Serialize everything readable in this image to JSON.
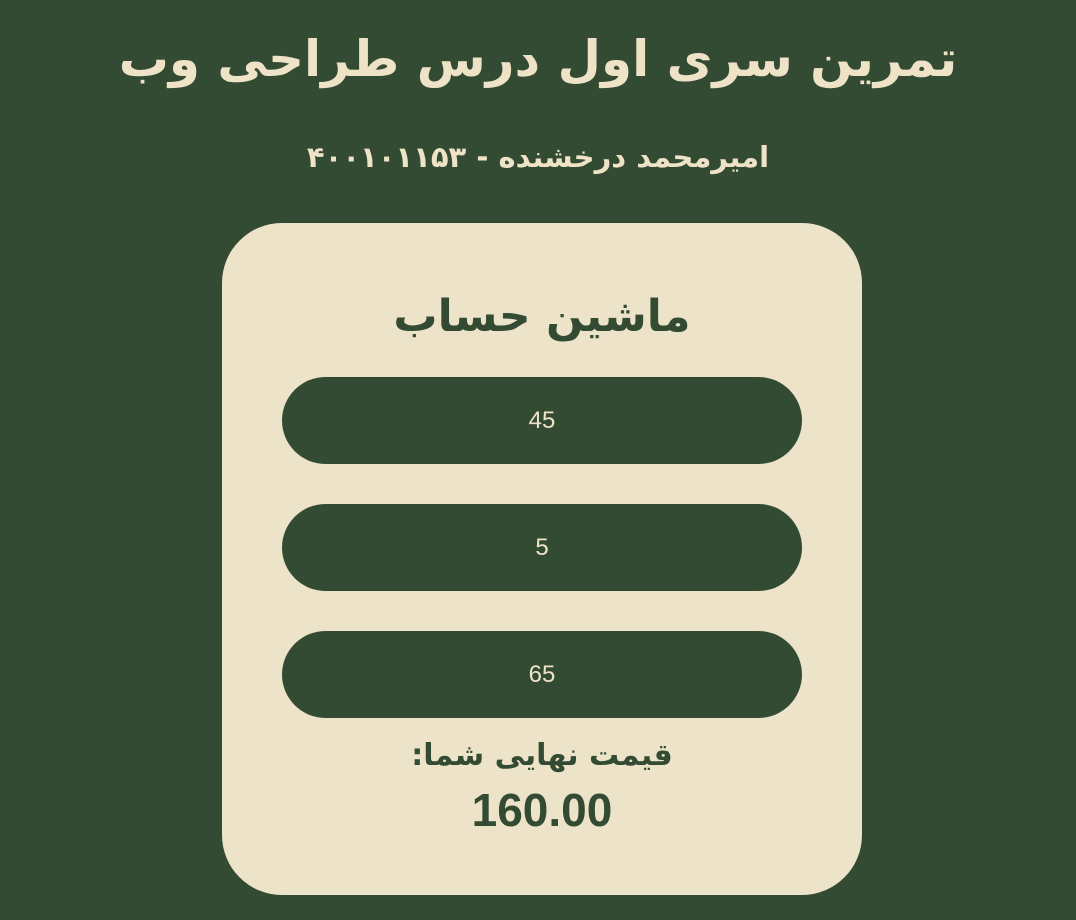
{
  "header": {
    "title": "تمرین سری اول درس طراحی وب",
    "subtitle": "امیرمحمد درخشنده - ۴۰۰۱۰۱۱۵۳"
  },
  "calculator": {
    "title": "ماشین حساب",
    "inputs": [
      {
        "value": "45"
      },
      {
        "value": "5"
      },
      {
        "value": "65"
      }
    ],
    "result_label": "قیمت نهایی شما:",
    "result_value": "160.00"
  },
  "colors": {
    "background": "#344b33",
    "card": "#ede3c8",
    "text_light": "#efe3c7",
    "text_dark": "#344b33"
  }
}
